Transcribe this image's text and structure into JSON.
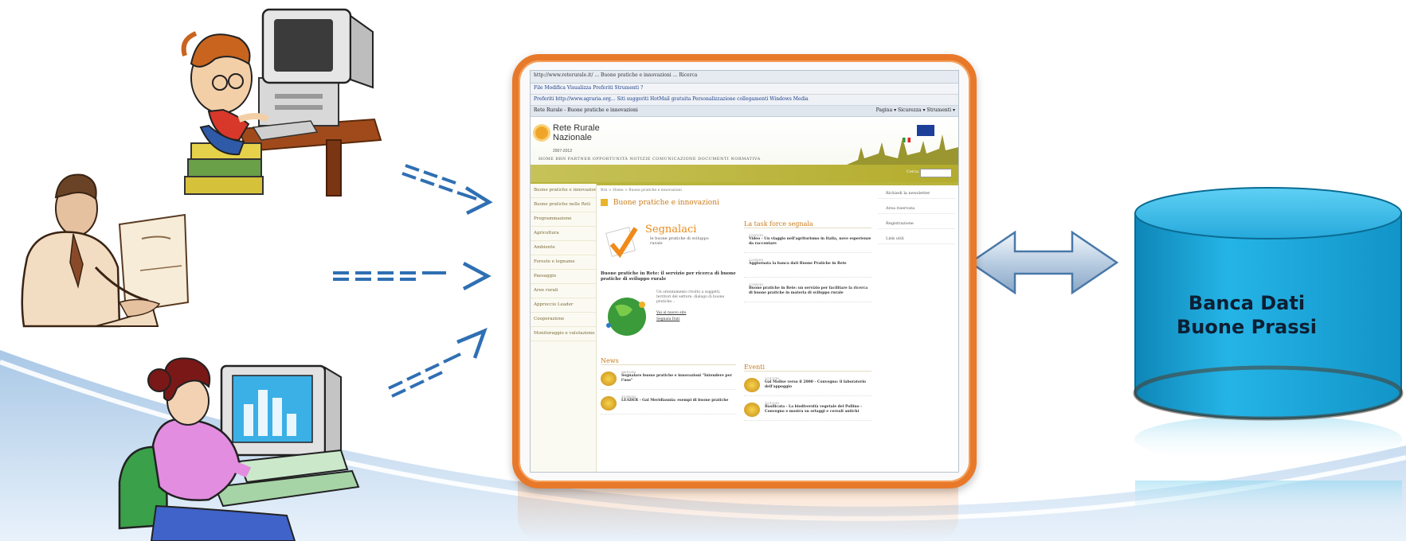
{
  "database": {
    "label_line1": "Banca Dati",
    "label_line2": "Buone Prassi"
  },
  "browser": {
    "toolbar_text": "http://www.reterurale.it/ ... Buone pratiche e innovazioni ... Ricerca",
    "menu": "File   Modifica   Visualizza   Preferiti   Strumenti   ?",
    "favorites": "Preferiti   http://www.agraria.org...   Siti suggeriti   HotMail gratuita   Personalizzazione collegamenti   Windows Media",
    "tab": "Rete Rurale - Buone pratiche e innovazioni",
    "page_menu": "Pagina ▾  Sicurezza ▾  Strumenti ▾"
  },
  "website": {
    "logo_line1": "Rete Rurale",
    "logo_line2": "Nazionale",
    "logo_years": "2007-2013",
    "nav": "HOME  RRN  PARTNER  OPPORTUNITÀ  NOTIZIE  COMUNICAZIONE  DOCUMENTI  NORMATIVA",
    "search_label": "Cerca",
    "sidebar_items": [
      "Buone pratiche e innovazioni",
      "Buone pratiche nelle Reti",
      "Programmazione",
      "Agricoltura",
      "Ambiente",
      "Foreste e legname",
      "Paesaggio",
      "Aree rurali",
      "Approccio Leader",
      "Cooperazione",
      "Monitoraggio e valutazione"
    ],
    "breadcrumb": "Rrn > Home > Buone pratiche e innovazioni",
    "page_title": "Buone pratiche e innovazioni",
    "banner_title": "Segnalaci",
    "banner_sub": "le buone pratiche di sviluppo rurale",
    "intro_bold": "Buone pratiche in Rete: il servizio per ricerca di buone pratiche di sviluppo rurale",
    "intro_text": "Un orientamento rivolto a soggetti, territori del settore, dialogo di buone pratiche...",
    "intro_link1": "Vai al nuovo sito",
    "intro_link2": "Segnala Dati",
    "taskforce_title": "La task force segnala",
    "taskforce_items": [
      {
        "date": "27/01/10",
        "text": "Video - Un viaggio nell'agriturismo in Italia, nove esperienze da raccontare"
      },
      {
        "date": "22/09/09",
        "text": "Aggiornata la banca dati Buone Pratiche in Rete"
      },
      {
        "date": "27/05/10",
        "text": "Buone pratiche in Rete: un servizio per facilitare la ricerca di buone pratiche in materia di sviluppo rurale"
      }
    ],
    "news_title": "News",
    "news_items": [
      {
        "date": "06/10/10",
        "text": "Segnalare buone pratiche e innovazioni \"Intendere per l'uso\""
      },
      {
        "date": "11/08/10",
        "text": "LEADER - Gal Meridiaunia: esempi di buone pratiche"
      }
    ],
    "events_title": "Eventi",
    "events_items": [
      {
        "date": "27/11/10",
        "text": "Gal Molise verso il 2000 - Convegno: il laboratorio dell'appoggio"
      },
      {
        "date": "12/11/10",
        "text": "Basilicata - La biodiversità vegetale del Pollino - Convegno e mostra su ortaggi e cereali antichi"
      }
    ],
    "right_links": [
      "Richiedi la newsletter",
      "Area riservata",
      "Registrazione",
      "Link utili"
    ]
  },
  "colors": {
    "frame_orange": "#e8792a",
    "database_blue": "#1aa2d4",
    "arrow_blue": "#2f6fb3",
    "hill_blue": "#b8d4ea"
  }
}
